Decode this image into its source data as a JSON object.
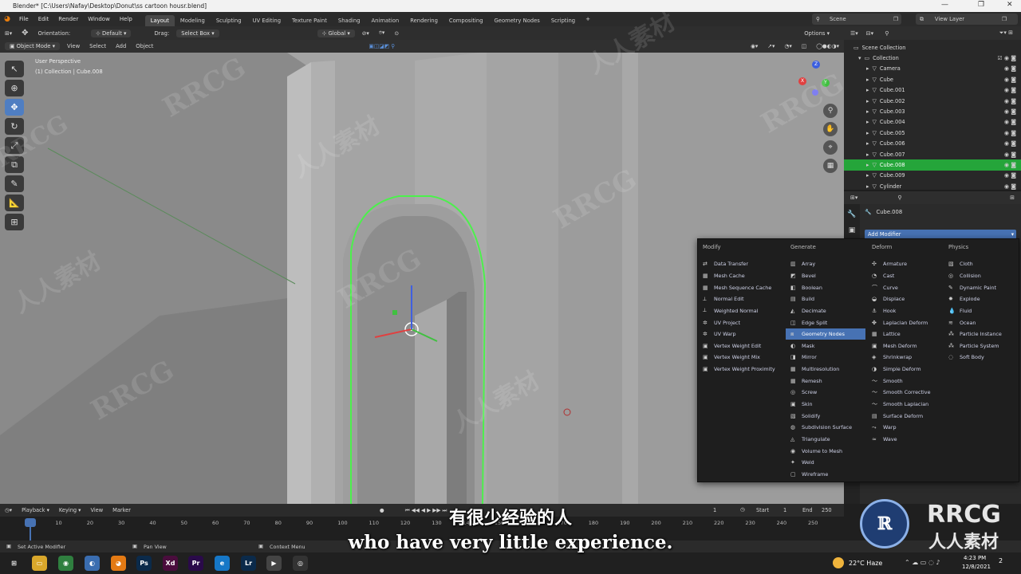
{
  "window": {
    "title": "Blender* [C:\\Users\\Nafay\\Desktop\\Donut\\ss cartoon housr.blend]",
    "controls": [
      "—",
      "❐",
      "✕"
    ]
  },
  "menus": [
    "File",
    "Edit",
    "Render",
    "Window",
    "Help"
  ],
  "workspaces": [
    {
      "label": "Layout",
      "active": true
    },
    {
      "label": "Modeling",
      "active": false
    },
    {
      "label": "Sculpting",
      "active": false
    },
    {
      "label": "UV Editing",
      "active": false
    },
    {
      "label": "Texture Paint",
      "active": false
    },
    {
      "label": "Shading",
      "active": false
    },
    {
      "label": "Animation",
      "active": false
    },
    {
      "label": "Rendering",
      "active": false
    },
    {
      "label": "Compositing",
      "active": false
    },
    {
      "label": "Geometry Nodes",
      "active": false
    },
    {
      "label": "Scripting",
      "active": false
    }
  ],
  "add_workspace": "+",
  "scene": {
    "label": "Scene"
  },
  "view_layer": {
    "label": "View Layer"
  },
  "viewport_header": {
    "orientation_label": "Orientation:",
    "orientation_value": "Default",
    "drag_label": "Drag:",
    "drag_value": "Select Box",
    "transform_global": "Global",
    "options": "Options"
  },
  "viewport_header2": {
    "mode": "Object Mode",
    "view": "View",
    "select": "Select",
    "add": "Add",
    "object": "Object"
  },
  "viewport_info": {
    "line1": "User Perspective",
    "line2": "(1) Collection | Cube.008"
  },
  "gizmo": {
    "x": "X",
    "y": "Y",
    "z": "Z"
  },
  "tools": [
    {
      "icon": "↖",
      "name": "select-box-tool",
      "active": false
    },
    {
      "icon": "⊕",
      "name": "cursor-tool",
      "active": false
    },
    {
      "icon": "✥",
      "name": "move-tool",
      "active": true
    },
    {
      "icon": "↻",
      "name": "rotate-tool",
      "active": false
    },
    {
      "icon": "⤢",
      "name": "scale-tool",
      "active": false
    },
    {
      "icon": "⧉",
      "name": "transform-tool",
      "active": false
    },
    {
      "icon": "✎",
      "name": "annotate-tool",
      "active": false
    },
    {
      "icon": "📐",
      "name": "measure-tool",
      "active": false
    },
    {
      "icon": "⊞",
      "name": "add-cube-tool",
      "active": false
    }
  ],
  "outliner": {
    "scene_collection": "Scene Collection",
    "collection": "Collection",
    "items": [
      {
        "name": "Camera",
        "selected": false
      },
      {
        "name": "Cube",
        "selected": false
      },
      {
        "name": "Cube.001",
        "selected": false
      },
      {
        "name": "Cube.002",
        "selected": false
      },
      {
        "name": "Cube.003",
        "selected": false
      },
      {
        "name": "Cube.004",
        "selected": false
      },
      {
        "name": "Cube.005",
        "selected": false
      },
      {
        "name": "Cube.006",
        "selected": false
      },
      {
        "name": "Cube.007",
        "selected": false
      },
      {
        "name": "Cube.008",
        "selected": true
      },
      {
        "name": "Cube.009",
        "selected": false
      },
      {
        "name": "Cylinder",
        "selected": false
      }
    ]
  },
  "properties": {
    "object_name": "Cube.008",
    "add_modifier": "Add Modifier"
  },
  "modifier_menu": {
    "columns": [
      {
        "title": "Modify",
        "items": [
          {
            "label": "Data Transfer",
            "icon": "⇄"
          },
          {
            "label": "Mesh Cache",
            "icon": "▦"
          },
          {
            "label": "Mesh Sequence Cache",
            "icon": "▦"
          },
          {
            "label": "Normal Edit",
            "icon": "⟂"
          },
          {
            "label": "Weighted Normal",
            "icon": "⟂"
          },
          {
            "label": "UV Project",
            "icon": "✲"
          },
          {
            "label": "UV Warp",
            "icon": "✲"
          },
          {
            "label": "Vertex Weight Edit",
            "icon": "▣"
          },
          {
            "label": "Vertex Weight Mix",
            "icon": "▣"
          },
          {
            "label": "Vertex Weight Proximity",
            "icon": "▣"
          }
        ]
      },
      {
        "title": "Generate",
        "items": [
          {
            "label": "Array",
            "icon": "▥"
          },
          {
            "label": "Bevel",
            "icon": "◩"
          },
          {
            "label": "Boolean",
            "icon": "◧"
          },
          {
            "label": "Build",
            "icon": "▤"
          },
          {
            "label": "Decimate",
            "icon": "◭"
          },
          {
            "label": "Edge Split",
            "icon": "◫"
          },
          {
            "label": "Geometry Nodes",
            "icon": "⧈",
            "highlight": true
          },
          {
            "label": "Mask",
            "icon": "◐"
          },
          {
            "label": "Mirror",
            "icon": "◨"
          },
          {
            "label": "Multiresolution",
            "icon": "▦"
          },
          {
            "label": "Remesh",
            "icon": "▦"
          },
          {
            "label": "Screw",
            "icon": "◎"
          },
          {
            "label": "Skin",
            "icon": "▣"
          },
          {
            "label": "Solidify",
            "icon": "▧"
          },
          {
            "label": "Subdivision Surface",
            "icon": "◍"
          },
          {
            "label": "Triangulate",
            "icon": "◬"
          },
          {
            "label": "Volume to Mesh",
            "icon": "◉"
          },
          {
            "label": "Weld",
            "icon": "✦"
          },
          {
            "label": "Wireframe",
            "icon": "▢"
          }
        ]
      },
      {
        "title": "Deform",
        "items": [
          {
            "label": "Armature",
            "icon": "✣"
          },
          {
            "label": "Cast",
            "icon": "◔"
          },
          {
            "label": "Curve",
            "icon": "⌒"
          },
          {
            "label": "Displace",
            "icon": "◒"
          },
          {
            "label": "Hook",
            "icon": "⚓"
          },
          {
            "label": "Laplacian Deform",
            "icon": "✤"
          },
          {
            "label": "Lattice",
            "icon": "▦"
          },
          {
            "label": "Mesh Deform",
            "icon": "▣"
          },
          {
            "label": "Shrinkwrap",
            "icon": "◈"
          },
          {
            "label": "Simple Deform",
            "icon": "◑"
          },
          {
            "label": "Smooth",
            "icon": "〜"
          },
          {
            "label": "Smooth Corrective",
            "icon": "〜"
          },
          {
            "label": "Smooth Laplacian",
            "icon": "〜"
          },
          {
            "label": "Surface Deform",
            "icon": "▤"
          },
          {
            "label": "Warp",
            "icon": "⤳"
          },
          {
            "label": "Wave",
            "icon": "≈"
          }
        ]
      },
      {
        "title": "Physics",
        "items": [
          {
            "label": "Cloth",
            "icon": "▧"
          },
          {
            "label": "Collision",
            "icon": "◎"
          },
          {
            "label": "Dynamic Paint",
            "icon": "✎"
          },
          {
            "label": "Explode",
            "icon": "✸"
          },
          {
            "label": "Fluid",
            "icon": "💧"
          },
          {
            "label": "Ocean",
            "icon": "≋"
          },
          {
            "label": "Particle Instance",
            "icon": "⁂"
          },
          {
            "label": "Particle System",
            "icon": "⁂"
          },
          {
            "label": "Soft Body",
            "icon": "◌"
          }
        ]
      }
    ]
  },
  "timeline": {
    "playback": "Playback",
    "keying": "Keying",
    "view": "View",
    "marker": "Marker",
    "current_frame": "1",
    "start_label": "Start",
    "start_value": "1",
    "end_label": "End",
    "end_value": "250",
    "frames": [
      "1",
      "10",
      "20",
      "30",
      "40",
      "50",
      "60",
      "70",
      "80",
      "90",
      "100",
      "110",
      "120",
      "130",
      "140",
      "150",
      "160",
      "170",
      "180",
      "190",
      "200",
      "210",
      "220",
      "230",
      "240",
      "250"
    ]
  },
  "statusbar": {
    "left": "Set Active Modifier",
    "middle": "Pan View",
    "right": "Context Menu"
  },
  "subtitles": {
    "cn": "有很少经验的人",
    "en": "who have very little experience."
  },
  "watermark": {
    "text1": "RRCG",
    "text2": "人人素材"
  },
  "logo": {
    "line1": "RRCG",
    "line2": "人人素材"
  },
  "taskbar": {
    "weather": "22°C Haze",
    "time": "4:23 PM",
    "date": "12/8/2021",
    "notification_count": "2",
    "apps": [
      {
        "label": "⊞",
        "name": "start-button",
        "color": "#202020"
      },
      {
        "label": "▭",
        "name": "file-explorer-app",
        "color": "#d9a72b"
      },
      {
        "label": "◉",
        "name": "chrome-app",
        "color": "#2f7f3f"
      },
      {
        "label": "◐",
        "name": "photos-app",
        "color": "#3a6db0"
      },
      {
        "label": "◕",
        "name": "blender-app",
        "color": "#e47a14"
      },
      {
        "label": "Ps",
        "name": "photoshop-app",
        "color": "#0b2a4a"
      },
      {
        "label": "Xd",
        "name": "xd-app",
        "color": "#4a0d3d"
      },
      {
        "label": "Pr",
        "name": "premiere-app",
        "color": "#2a0a4a"
      },
      {
        "label": "e",
        "name": "edge-app",
        "color": "#1677c7"
      },
      {
        "label": "Lr",
        "name": "lightroom-app",
        "color": "#0b2a4a"
      },
      {
        "label": "▶",
        "name": "media-app",
        "color": "#444"
      },
      {
        "label": "◎",
        "name": "obs-app",
        "color": "#333"
      }
    ]
  }
}
